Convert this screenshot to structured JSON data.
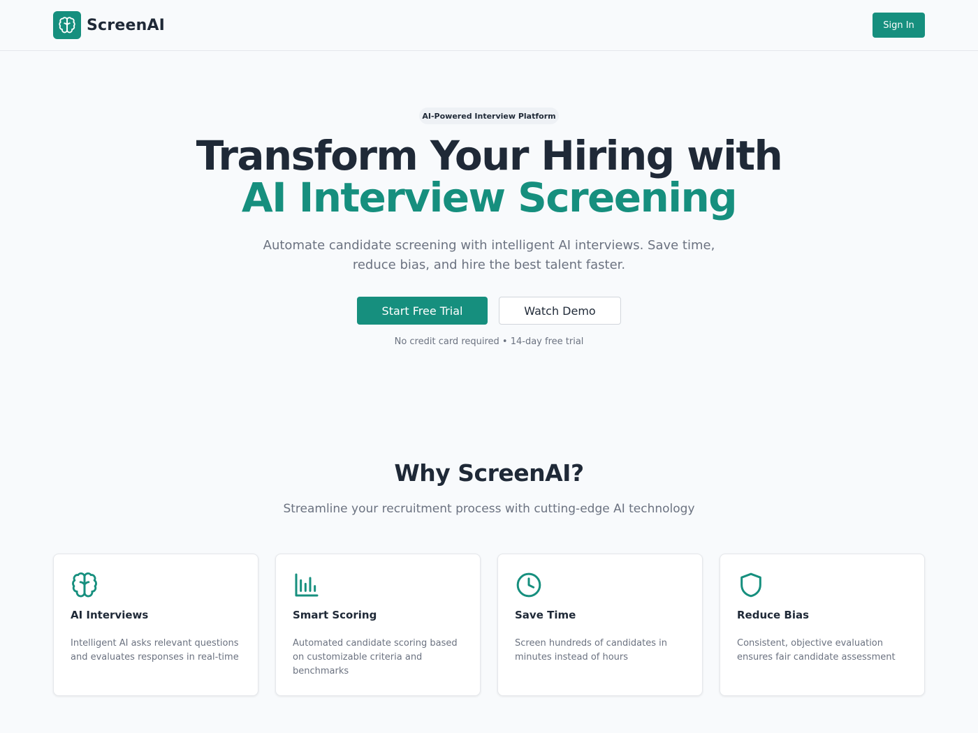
{
  "header": {
    "brand": "ScreenAI",
    "sign_in_label": "Sign In",
    "logo_icon": "brain-icon"
  },
  "hero": {
    "badge": "AI-Powered Interview Platform",
    "title_line1": "Transform Your Hiring with",
    "title_line2": "AI Interview Screening",
    "lead": "Automate candidate screening with intelligent AI interviews. Save time, reduce bias, and hire the best talent faster.",
    "primary_cta": "Start Free Trial",
    "secondary_cta": "Watch Demo",
    "note": "No credit card required • 14-day free trial"
  },
  "why": {
    "title": "Why ScreenAI?",
    "subtitle": "Streamline your recruitment process with cutting-edge AI technology"
  },
  "features": [
    {
      "icon": "brain-icon",
      "title": "AI Interviews",
      "desc": "Intelligent AI asks relevant questions and evaluates responses in real-time"
    },
    {
      "icon": "bar-chart-icon",
      "title": "Smart Scoring",
      "desc": "Automated candidate scoring based on customizable criteria and benchmarks"
    },
    {
      "icon": "clock-icon",
      "title": "Save Time",
      "desc": "Screen hundreds of candidates in minutes instead of hours"
    },
    {
      "icon": "shield-icon",
      "title": "Reduce Bias",
      "desc": "Consistent, objective evaluation ensures fair candidate assessment"
    }
  ],
  "colors": {
    "accent": "#168f7e",
    "heading": "#1f2937",
    "muted": "#6b7280",
    "background": "#f8fafc"
  }
}
